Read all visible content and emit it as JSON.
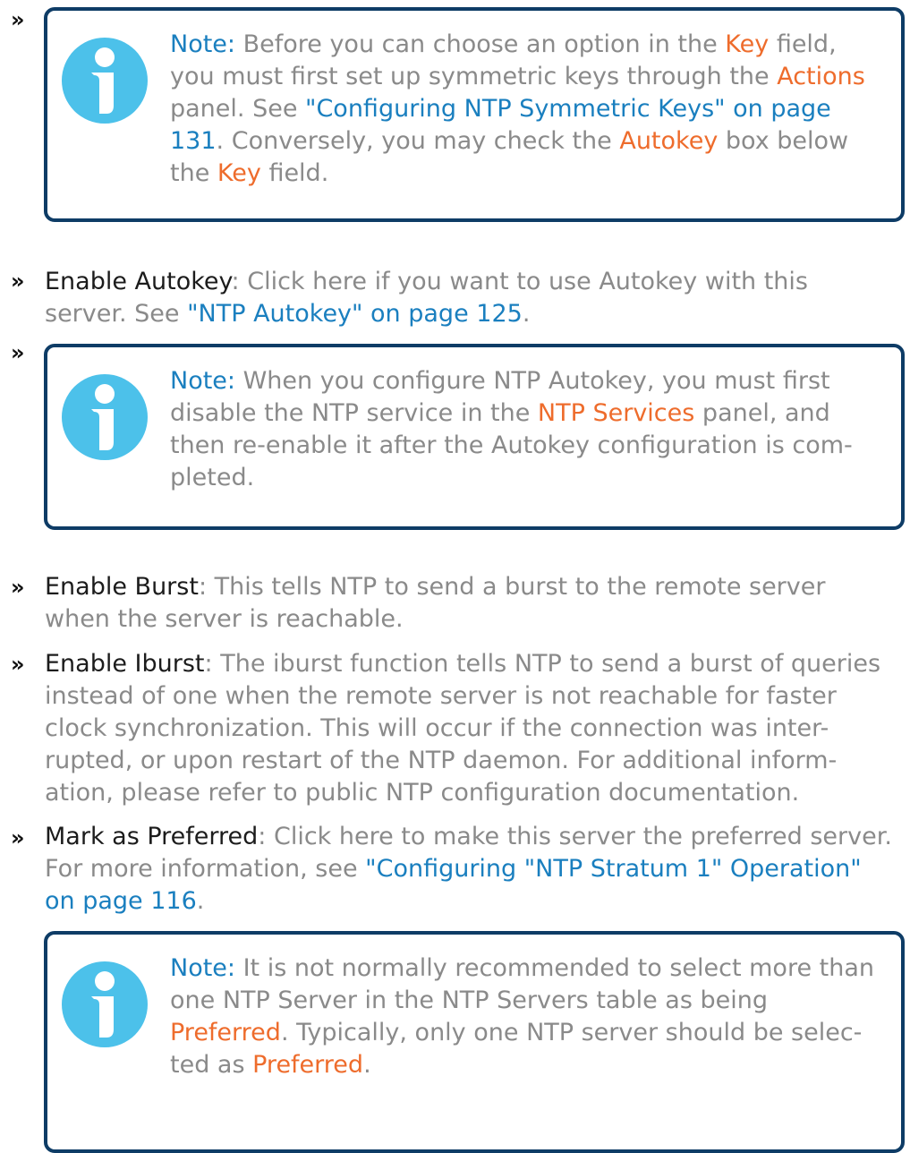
{
  "bullet_glyph": "»",
  "colors": {
    "link_blue": "#1a7fbf",
    "ui_orange": "#ee6c2c",
    "body_gray": "#8a8a8a",
    "term_dark": "#1c1c1c",
    "note_border": "#0e3c66",
    "info_icon": "#4cc1ea"
  },
  "icons": {
    "note_icon": "info-icon"
  },
  "note1": {
    "label": "Note:",
    "t1": " Before you can choose an option in the ",
    "key1": "Key",
    "t2": " field, you must first set up symmetric keys through the ",
    "actions": "Actions",
    "t3": " panel. See ",
    "link": "\"Configuring NTP Symmetric Keys\" on page 131",
    "t4": ". Conversely, you may check the ",
    "autokey": "Autokey",
    "t5": " box below the ",
    "key2": "Key",
    "t6": " field."
  },
  "autokey_item": {
    "term": "Enable Autokey",
    "t1": ": Click here if you want to use Autokey with this server. See ",
    "link": "\"NTP Autokey\" on page 125",
    "t2": "."
  },
  "note2": {
    "label": "Note:",
    "t1": " When you configure NTP Autokey, you must first disable the NTP service in the ",
    "services": "NTP Services",
    "t2": " panel, and then re-enable it after the Autokey configuration is com-pleted."
  },
  "burst_item": {
    "term": "Enable Burst",
    "t1": ": This tells NTP to send a burst to the remote server when the server is reachable."
  },
  "iburst_item": {
    "term": "Enable Iburst",
    "t1": ": The iburst function tells NTP to send a burst of queries instead of one when the remote server is not reachable for faster clock synchronization. This will occur if the connection was inter-rupted, or upon restart of the NTP daemon. For additional inform-ation, please refer to public NTP configuration documentation."
  },
  "preferred_item": {
    "term": "Mark as Preferred",
    "t1": ": Click here to make this server the preferred server. For more information, see ",
    "link": "\"Configuring \"NTP Stratum 1\" Operation\" on page 116",
    "t2": "."
  },
  "note3": {
    "label": "Note:",
    "t1": " It is not normally recommended to select more than one NTP Server in the NTP Servers table as being ",
    "pref1": "Preferred",
    "t2": ". Typically, only one NTP server should be selec-ted as ",
    "pref2": "Preferred",
    "t3": "."
  }
}
